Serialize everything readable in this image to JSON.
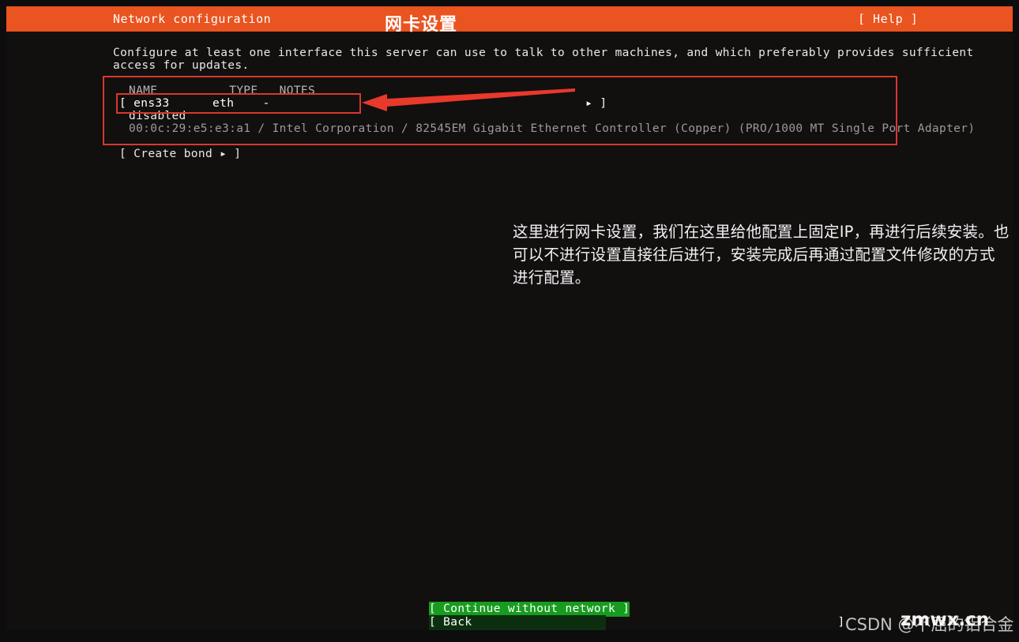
{
  "header": {
    "title": "Network configuration",
    "cn_title": "网卡设置",
    "help_label": "[ Help ]",
    "bar_color": "#e95420"
  },
  "intro": {
    "line1": "Configure at least one interface this server can use to talk to other machines, and which preferably provides sufficient",
    "line2": "access for updates."
  },
  "table": {
    "header_row": "NAME          TYPE   NOTES",
    "interface_row": "[ ens33      eth    -                                            ▸ ]",
    "status": "disabled",
    "device": "00:0c:29:e5:e3:a1 / Intel Corporation / 82545EM Gigabit Ethernet Controller (Copper) (PRO/1000 MT Single Port Adapter)",
    "columns": [
      "NAME",
      "TYPE",
      "NOTES"
    ],
    "rows": [
      {
        "name": "ens33",
        "type": "eth",
        "notes": "-",
        "status": "disabled",
        "device": "00:0c:29:e5:e3:a1 / Intel Corporation / 82545EM Gigabit Ethernet Controller (Copper) (PRO/1000 MT Single Port Adapter)"
      }
    ]
  },
  "actions": {
    "create_bond": "[ Create bond ▸ ]"
  },
  "annotation": {
    "note_text": "这里进行网卡设置，我们在这里给他配置上固定IP，再进行后续安装。也可以不进行设置直接往后进行，安装完成后再通过配置文件修改的方式进行配置。",
    "highlight_color": "#d8392b"
  },
  "footer": {
    "continue_label": "[ Continue without network ]",
    "back_label": "[ Back                                                   ]",
    "continue_color": "#179c1f",
    "back_color": "#0c2f10"
  },
  "watermarks": {
    "csdn": "CSDN @不屈的铝合金",
    "site": "zmwx.cn"
  }
}
